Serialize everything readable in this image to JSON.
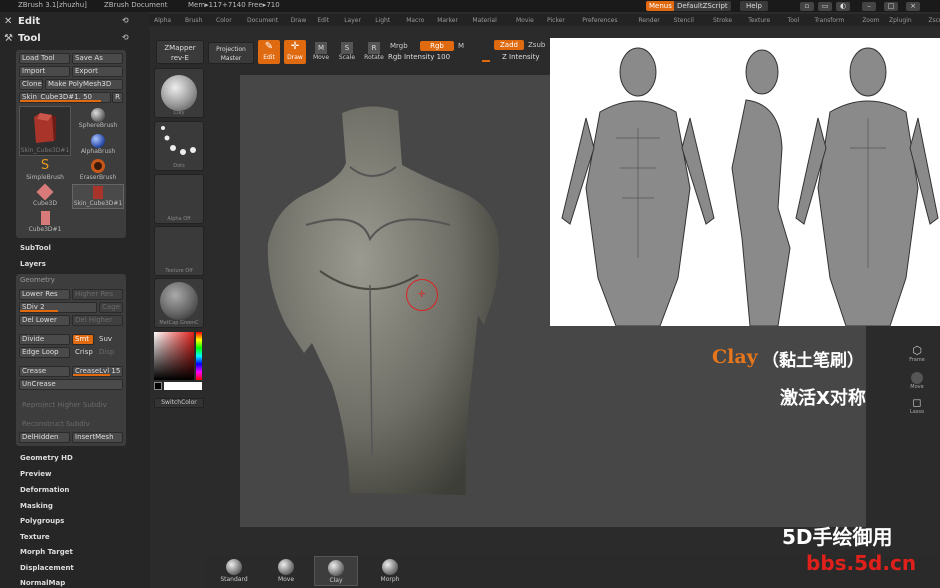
{
  "topbar": {
    "app_name": "ZBrush  3.1[zhuzhu]",
    "document": "ZBrush Document",
    "mem_info": "Mem▸117+7140  Free▸710",
    "menus_label": "Menus",
    "script_label": "DefaultZScript",
    "help_label": "Help"
  },
  "menubar": {
    "items": [
      "Alpha",
      "Brush",
      "Color",
      "Document",
      "Draw",
      "Edit",
      "Layer",
      "Light",
      "Macro",
      "Marker",
      "Material",
      "Movie",
      "Picker",
      "Preferences",
      "Render",
      "Stencil",
      "Stroke",
      "Texture",
      "Tool",
      "Transform",
      "Zoom",
      "Zplugin",
      "Zscript"
    ]
  },
  "left": {
    "edit_label": "Edit",
    "tool_label": "Tool",
    "buttons": {
      "load_tool": "Load Tool",
      "save_as": "Save As",
      "import": "Import",
      "export": "Export",
      "clone": "Clone",
      "make_polymesh": "Make PolyMesh3D",
      "current_tool": "Skin_Cube3D#1. 50",
      "r": "R"
    },
    "tools": [
      {
        "name": "Skin_Cube3D#1"
      },
      {
        "name": "SphereBrush"
      },
      {
        "name": "AlphaBrush"
      },
      {
        "name": "SimpleBrush"
      },
      {
        "name": "EraserBrush"
      },
      {
        "name": "Cube3D"
      },
      {
        "name": "Skin_Cube3D#1"
      },
      {
        "name": "Cube3D#1"
      }
    ],
    "subtool": "SubTool",
    "layers": "Layers",
    "geometry": {
      "title": "Geometry",
      "lower_res": "Lower Res",
      "higher_res": "Higher Res",
      "sdiv": "SDiv 2",
      "sdiv_fraction": 0.5,
      "cage": "Cage",
      "del_lower": "Del Lower",
      "del_higher": "Del Higher",
      "divide": "Divide",
      "smt": "Smt",
      "suv": "Suv",
      "edge_loop": "Edge Loop",
      "crisp": "Crisp",
      "disp": "Disp",
      "crease": "Crease",
      "crease_lvl": "CreaseLvl 15",
      "crease_fraction": 0.75,
      "uncrease": "UnCrease",
      "reproject": "Reproject Higher Subdiv",
      "reconstruct": "Reconstruct Subdiv",
      "del_hidden": "DelHidden",
      "insert_mesh": "InsertMesh"
    },
    "sections": [
      "Geometry HD",
      "Preview",
      "Deformation",
      "Masking",
      "Polygroups",
      "Texture",
      "Morph Target",
      "Displacement",
      "NormalMap"
    ]
  },
  "shelf": {
    "items": [
      "Clay",
      "Dots",
      "Alpha  Off",
      "Texture  Off",
      "MatCap  GreenC"
    ],
    "switch_color": "SwitchColor"
  },
  "toolbar": {
    "zmapper": "ZMapper",
    "zmapper_rev": "rev-E",
    "projection": "Projection",
    "projection_master": "Master",
    "edit": "Edit",
    "draw": "Draw",
    "move": "Move",
    "scale": "Scale",
    "rotate": "Rotate",
    "mrgb": "Mrgb",
    "rgb": "Rgb",
    "m": "M",
    "rgb_intensity": "Rgb Intensity 100",
    "zadd": "Zadd",
    "zsub": "Zsub",
    "z_intensity": "Z Intensity"
  },
  "right_tools": [
    "Frame",
    "Move",
    "Lasso"
  ],
  "bottom": {
    "brushes": [
      "Standard",
      "Move",
      "Clay",
      "Morph"
    ]
  },
  "overlay": {
    "clay_title": "Clay",
    "clay_sub": "（黏土笔刷）",
    "activate_text": "激活X对称",
    "watermark_1": "5D手绘御用",
    "watermark_2": "bbs.5d.cn"
  },
  "colors": {
    "accent": "#e06a10",
    "overlay_orange": "#e8761a",
    "watermark_red": "#e0201a"
  }
}
